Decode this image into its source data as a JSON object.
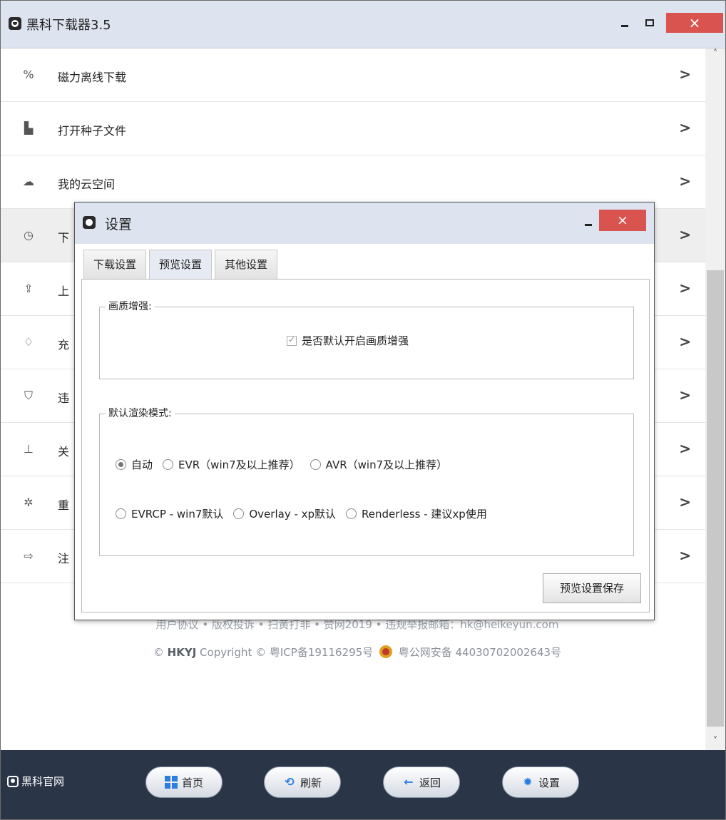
{
  "window": {
    "title": "黑科下载器3.5",
    "minimize": "–",
    "maximize": "□",
    "close": "×"
  },
  "menu": {
    "items": [
      {
        "icon": "link-icon",
        "label": "磁力离线下载",
        "chevron": ">"
      },
      {
        "icon": "file-icon",
        "label": "打开种子文件",
        "chevron": ">"
      },
      {
        "icon": "cloud-icon",
        "label": "我的云空间",
        "chevron": ">"
      },
      {
        "icon": "clock-icon",
        "label": "下",
        "chevron": ">"
      },
      {
        "icon": "upload-icon",
        "label": "上",
        "chevron": ">"
      },
      {
        "icon": "diamond-icon",
        "label": "充",
        "chevron": ">"
      },
      {
        "icon": "shield-icon",
        "label": "违",
        "chevron": ">"
      },
      {
        "icon": "sitemap-icon",
        "label": "关",
        "chevron": ">"
      },
      {
        "icon": "gear-icon",
        "label": "重",
        "chevron": ">"
      },
      {
        "icon": "logout-icon",
        "label": "注",
        "chevron": ">"
      }
    ]
  },
  "footer": {
    "line1": "用户协议 • 版权投诉 • 扫黄打非 • 赞网2019 • 违规举报邮箱：hk@heikeyun.com",
    "copyright_prefix": "© ",
    "brand": "HKYJ",
    "copyright_rest": " Copyright © 粤ICP备19116295号",
    "police": " 粤公网安备 44030702002643号"
  },
  "bottombar": {
    "site_link": "黑科官网",
    "buttons": {
      "home": "首页",
      "refresh": "刷新",
      "back": "返回",
      "settings": "设置"
    }
  },
  "dialog": {
    "title": "设置",
    "minimize": "–",
    "close": "×",
    "tabs": [
      "下载设置",
      "预览设置",
      "其他设置"
    ],
    "active_tab": "预览设置",
    "group_enhance": {
      "legend": "画质增强:",
      "checkbox_label": "是否默认开启画质增强",
      "checked": true
    },
    "group_render": {
      "legend": "默认渲染模式:",
      "options_row1": [
        "自动",
        "EVR（win7及以上推荐）",
        "AVR（win7及以上推荐）"
      ],
      "options_row2": [
        "EVRCP - win7默认",
        "Overlay - xp默认",
        "Renderless - 建议xp使用"
      ],
      "selected": "自动"
    },
    "save_button": "预览设置保存"
  },
  "colors": {
    "titlebar": "#dde3ef",
    "bottombar": "#2b3548",
    "close": "#d9534f",
    "accent": "#2b7de0"
  }
}
